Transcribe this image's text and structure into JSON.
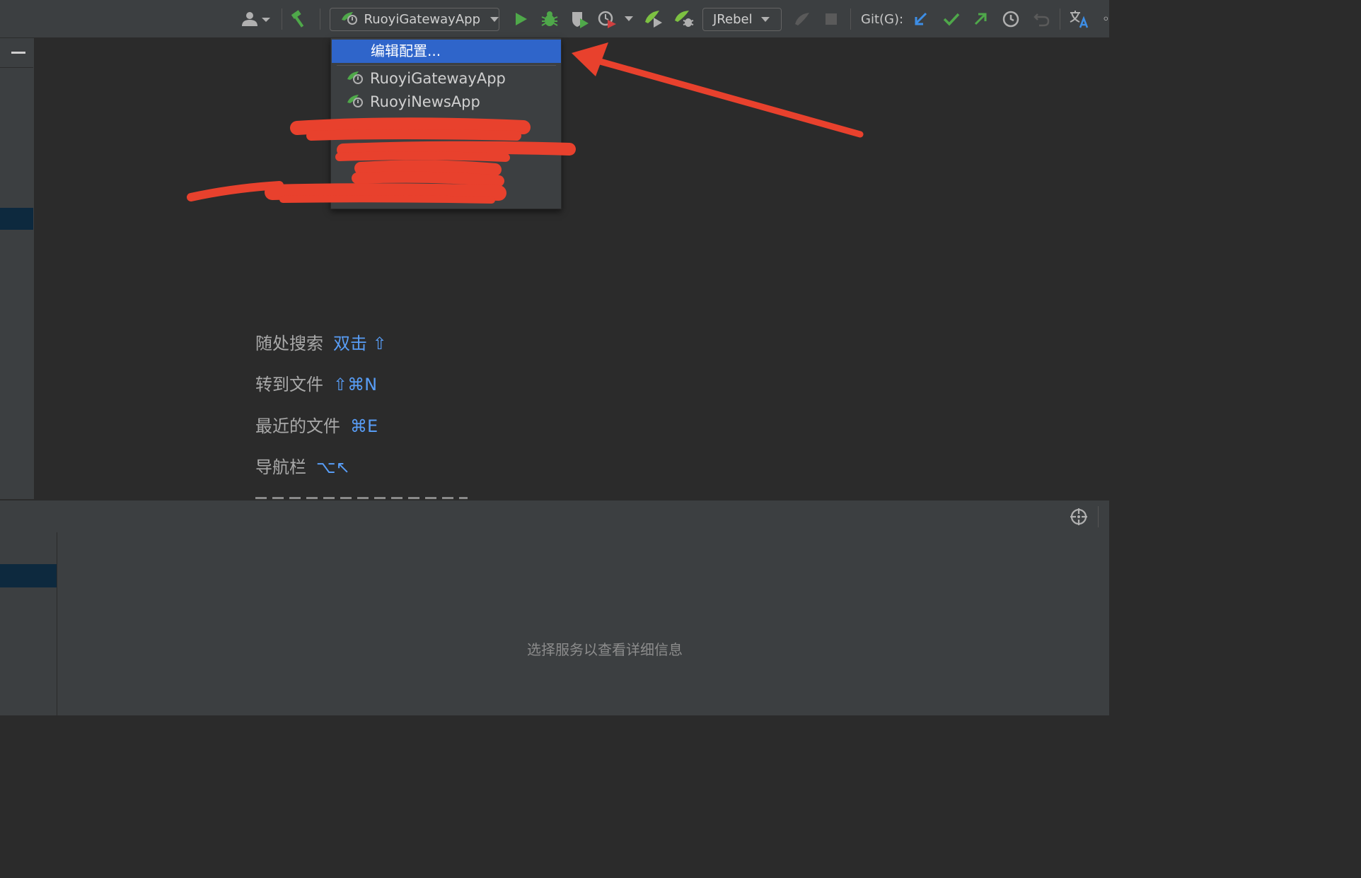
{
  "toolbar": {
    "run_config": "RuoyiGatewayApp",
    "jrebel": "JRebel",
    "git_label": "Git(G):"
  },
  "dropdown": {
    "edit_config": "编辑配置...",
    "items": [
      "RuoyiGatewayApp",
      "RuoyiNewsApp"
    ]
  },
  "hints": [
    {
      "label": "随处搜索",
      "key": "双击 ⇧"
    },
    {
      "label": "转到文件",
      "key": "⇧⌘N"
    },
    {
      "label": "最近的文件",
      "key": "⌘E"
    },
    {
      "label": "导航栏",
      "key": "⌥↖"
    }
  ],
  "services": {
    "empty_message": "选择服务以查看详细信息"
  },
  "colors": {
    "accent": "#2f65ca",
    "run_green": "#4fa84a",
    "annotation_red": "#e8412d"
  }
}
